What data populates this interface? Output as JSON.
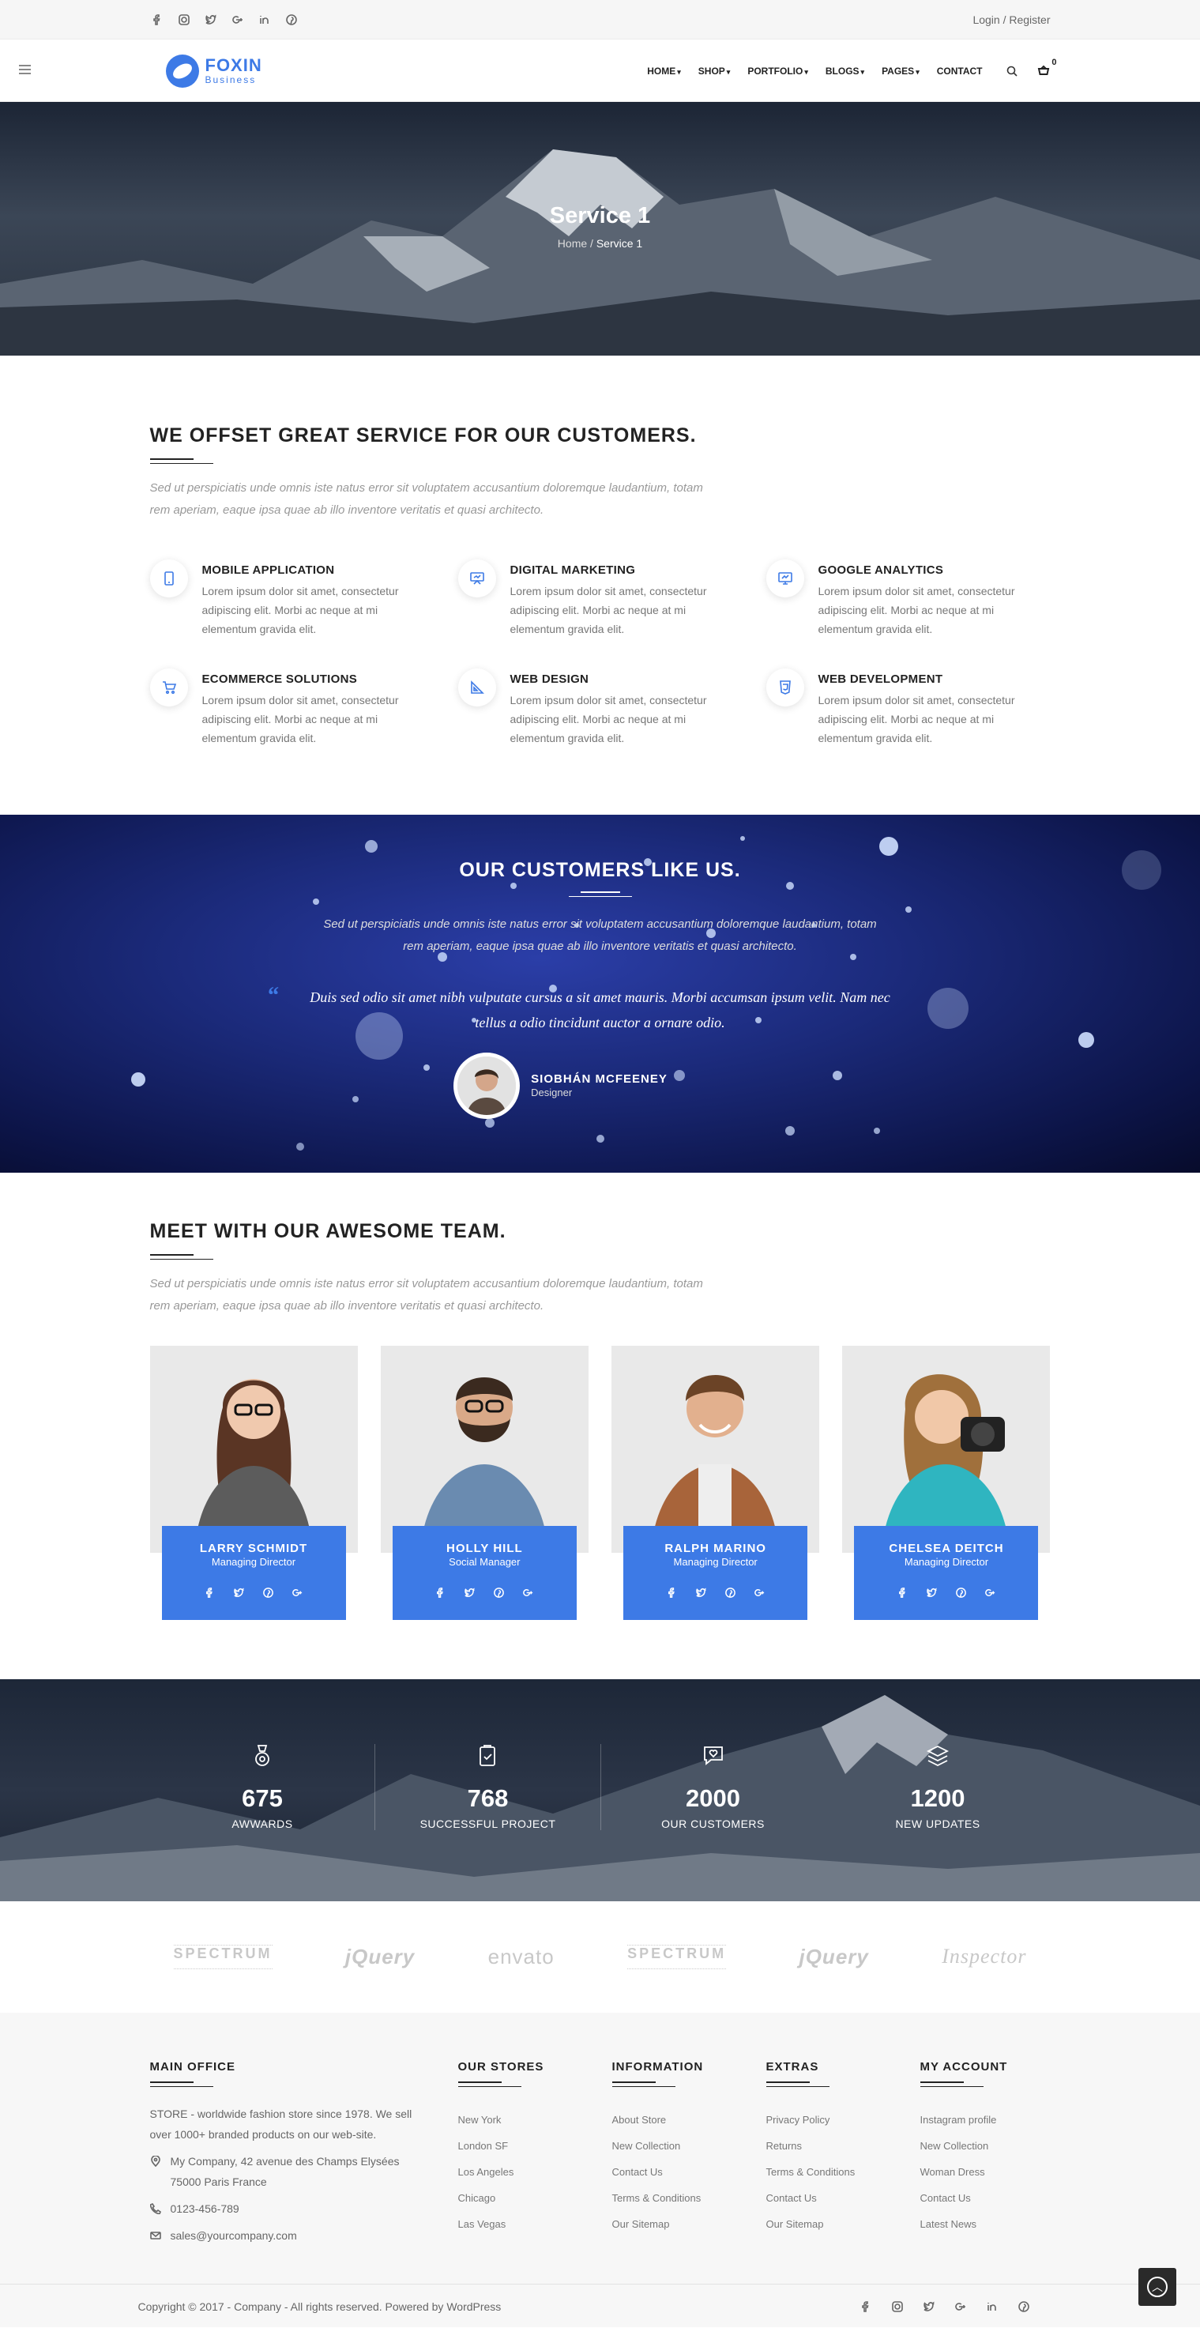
{
  "topbar": {
    "login": "Login / Register"
  },
  "logo": {
    "name": "FOXIN",
    "tagline": "Business"
  },
  "nav": {
    "items": [
      "HOME",
      "SHOP",
      "PORTFOLIO",
      "BLOGS",
      "PAGES",
      "CONTACT"
    ],
    "cart_count": "0"
  },
  "hero": {
    "title": "Service 1",
    "crumb_home": "Home",
    "crumb_sep": " / ",
    "crumb_current": "Service 1"
  },
  "services": {
    "title": "WE OFFSET GREAT SERVICE FOR OUR CUSTOMERS.",
    "subtitle": "Sed ut perspiciatis unde omnis iste natus error sit voluptatem accusantium doloremque laudantium, totam rem aperiam, eaque ipsa quae ab illo inventore veritatis et quasi architecto.",
    "items": [
      {
        "title": "MOBILE APPLICATION",
        "text": "Lorem ipsum dolor sit amet, consectetur adipiscing elit. Morbi ac neque at mi elementum gravida elit.",
        "icon": "mobile-icon"
      },
      {
        "title": "DIGITAL MARKETING",
        "text": "Lorem ipsum dolor sit amet, consectetur adipiscing elit. Morbi ac neque at mi elementum gravida elit.",
        "icon": "presentation-icon"
      },
      {
        "title": "GOOGLE ANALYTICS",
        "text": "Lorem ipsum dolor sit amet, consectetur adipiscing elit. Morbi ac neque at mi elementum gravida elit.",
        "icon": "monitor-icon"
      },
      {
        "title": "ECOMMERCE SOLUTIONS",
        "text": "Lorem ipsum dolor sit amet, consectetur adipiscing elit. Morbi ac neque at mi elementum gravida elit.",
        "icon": "cart-icon"
      },
      {
        "title": "WEB DESIGN",
        "text": "Lorem ipsum dolor sit amet, consectetur adipiscing elit. Morbi ac neque at mi elementum gravida elit.",
        "icon": "design-icon"
      },
      {
        "title": "WEB DEVELOPMENT",
        "text": "Lorem ipsum dolor sit amet, consectetur adipiscing elit. Morbi ac neque at mi elementum gravida elit.",
        "icon": "code-icon"
      }
    ]
  },
  "testimonial": {
    "title": "OUR CUSTOMERS LIKE US.",
    "subtitle": "Sed ut perspiciatis unde omnis iste natus error sit voluptatem accusantium doloremque laudantium, totam rem aperiam, eaque ipsa quae ab illo inventore veritatis et quasi architecto.",
    "quote": "Duis sed odio sit amet nibh vulputate cursus a sit amet mauris. Morbi accumsan ipsum velit. Nam nec tellus a odio tincidunt auctor a ornare odio.",
    "author": "SIOBHÁN MCFEENEY",
    "role": "Designer"
  },
  "team": {
    "title": "MEET WITH OUR AWESOME TEAM.",
    "subtitle": "Sed ut perspiciatis unde omnis iste natus error sit voluptatem accusantium doloremque laudantium, totam rem aperiam, eaque ipsa quae ab illo inventore veritatis et quasi architecto.",
    "members": [
      {
        "name": "LARRY SCHMIDT",
        "role": "Managing Director"
      },
      {
        "name": "HOLLY HILL",
        "role": "Social Manager"
      },
      {
        "name": "RALPH MARINO",
        "role": "Managing Director"
      },
      {
        "name": "CHELSEA DEITCH",
        "role": "Managing Director"
      }
    ]
  },
  "counters": [
    {
      "number": "675",
      "label": "AWWARDS",
      "icon": "medal-icon"
    },
    {
      "number": "768",
      "label": "SUCCESSFUL PROJECT",
      "icon": "clipboard-check-icon"
    },
    {
      "number": "2000",
      "label": "OUR CUSTOMERS",
      "icon": "chat-heart-icon"
    },
    {
      "number": "1200",
      "label": "NEW UPDATES",
      "icon": "layers-icon"
    }
  ],
  "brands": [
    "SPECTRUM",
    "jQuery",
    "envato",
    "SPECTRUM",
    "jQuery",
    "Inspector"
  ],
  "footer": {
    "main_office": {
      "title": "MAIN OFFICE",
      "text": "STORE - worldwide fashion store since 1978. We sell over 1000+ branded products on our web-site.",
      "address": "My Company, 42 avenue des Champs Elysées 75000 Paris France",
      "phone": "0123-456-789",
      "email": "sales@yourcompany.com"
    },
    "columns": [
      {
        "title": "OUR STORES",
        "links": [
          "New York",
          "London SF",
          "Los Angeles",
          "Chicago",
          "Las Vegas"
        ]
      },
      {
        "title": "INFORMATION",
        "links": [
          "About Store",
          "New Collection",
          "Contact Us",
          "Terms & Conditions",
          "Our Sitemap"
        ]
      },
      {
        "title": "EXTRAS",
        "links": [
          "Privacy Policy",
          "Returns",
          "Terms & Conditions",
          "Contact Us",
          "Our Sitemap"
        ]
      },
      {
        "title": "MY ACCOUNT",
        "links": [
          "Instagram profile",
          "New Collection",
          "Woman Dress",
          "Contact Us",
          "Latest News"
        ]
      }
    ],
    "copyright": "Copyright © 2017 - Company - All rights reserved. Powered by WordPress"
  },
  "colors": {
    "accent": "#3d7ae6"
  }
}
